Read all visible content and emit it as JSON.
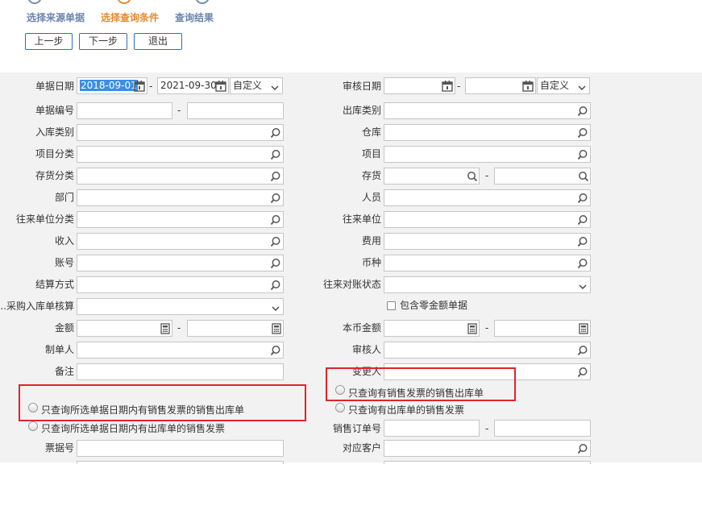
{
  "steps": [
    {
      "label": "选择来源单据",
      "active": false
    },
    {
      "label": "选择查询条件",
      "active": true
    },
    {
      "label": "查询结果",
      "active": false
    }
  ],
  "buttons": {
    "prev": "上一步",
    "next": "下一步",
    "exit": "退出"
  },
  "left": {
    "doc_date": {
      "label": "单据日期",
      "from": "2018-09-01",
      "to": "2021-09-30",
      "range": "自定义"
    },
    "doc_no": {
      "label": "单据编号"
    },
    "in_type": {
      "label": "入库类别"
    },
    "proj_cat": {
      "label": "项目分类"
    },
    "inv_cat": {
      "label": "存货分类"
    },
    "dept": {
      "label": "部门"
    },
    "partner_cat": {
      "label": "往来单位分类"
    },
    "income": {
      "label": "收入"
    },
    "account": {
      "label": "账号"
    },
    "settle": {
      "label": "结算方式"
    },
    "purchase_calc": {
      "label": "采购入库单核算..."
    },
    "amount": {
      "label": "金额"
    },
    "maker": {
      "label": "制单人"
    },
    "remark": {
      "label": "备注"
    },
    "ticket_no": {
      "label": "票据号"
    }
  },
  "right": {
    "audit_date": {
      "label": "审核日期",
      "range": "自定义"
    },
    "out_type": {
      "label": "出库类别"
    },
    "warehouse": {
      "label": "仓库"
    },
    "project": {
      "label": "项目"
    },
    "inventory": {
      "label": "存货"
    },
    "person": {
      "label": "人员"
    },
    "partner": {
      "label": "往来单位"
    },
    "expense": {
      "label": "费用"
    },
    "currency": {
      "label": "币种"
    },
    "reconcile": {
      "label": "往来对账状态"
    },
    "zero_amount": {
      "label": "包含零金额单据"
    },
    "local_amount": {
      "label": "本币金额"
    },
    "auditor": {
      "label": "审核人"
    },
    "changer": {
      "label": "变更人"
    },
    "sales_order": {
      "label": "销售订单号"
    },
    "customer": {
      "label": "对应客户"
    }
  },
  "options": {
    "opt1": "只查询所选单据日期内有销售发票的销售出库单",
    "opt2": "只查询所选单据日期内有出库单的销售发票",
    "opt3": "只查询有销售发票的销售出库单",
    "opt4": "只查询有出库单的销售发票"
  },
  "colors": {
    "accent_orange": "#e58a2e",
    "step_blue": "#6b84ad",
    "highlight_red": "#e0242c",
    "button_border": "#2f6fb5"
  }
}
